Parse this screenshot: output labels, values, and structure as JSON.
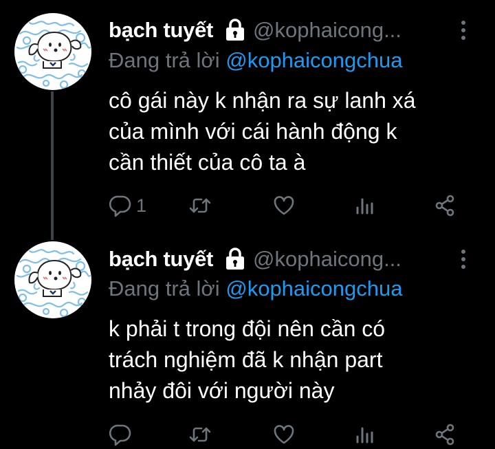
{
  "tweets": [
    {
      "name": "bạch tuyết",
      "handle": "@kophaicong...",
      "reply_prefix": "Đang trả lời ",
      "reply_mention": "@kophaicongchua",
      "text_lines": [
        "cô gái này k nhận ra sự lanh xá",
        "của mình với cái hành động k",
        "cần thiết của cô ta à"
      ],
      "reply_count": "1"
    },
    {
      "name": "bạch tuyết",
      "handle": "@kophaicong...",
      "reply_prefix": "Đang trả lời ",
      "reply_mention": "@kophaicongchua",
      "text_lines": [
        "k phải t trong đội nên cần có",
        "trách nghiệm đã k nhận part",
        "nhảy đôi với người này"
      ],
      "reply_count": ""
    }
  ],
  "colors": {
    "background": "#000000",
    "text": "#ffffff",
    "secondary": "#6e767d",
    "accent": "#1d9bf0",
    "thread_line": "#3d4349"
  },
  "icons": [
    "lock-icon",
    "more-icon",
    "reply-icon",
    "retweet-icon",
    "like-icon",
    "stats-icon",
    "share-icon"
  ]
}
